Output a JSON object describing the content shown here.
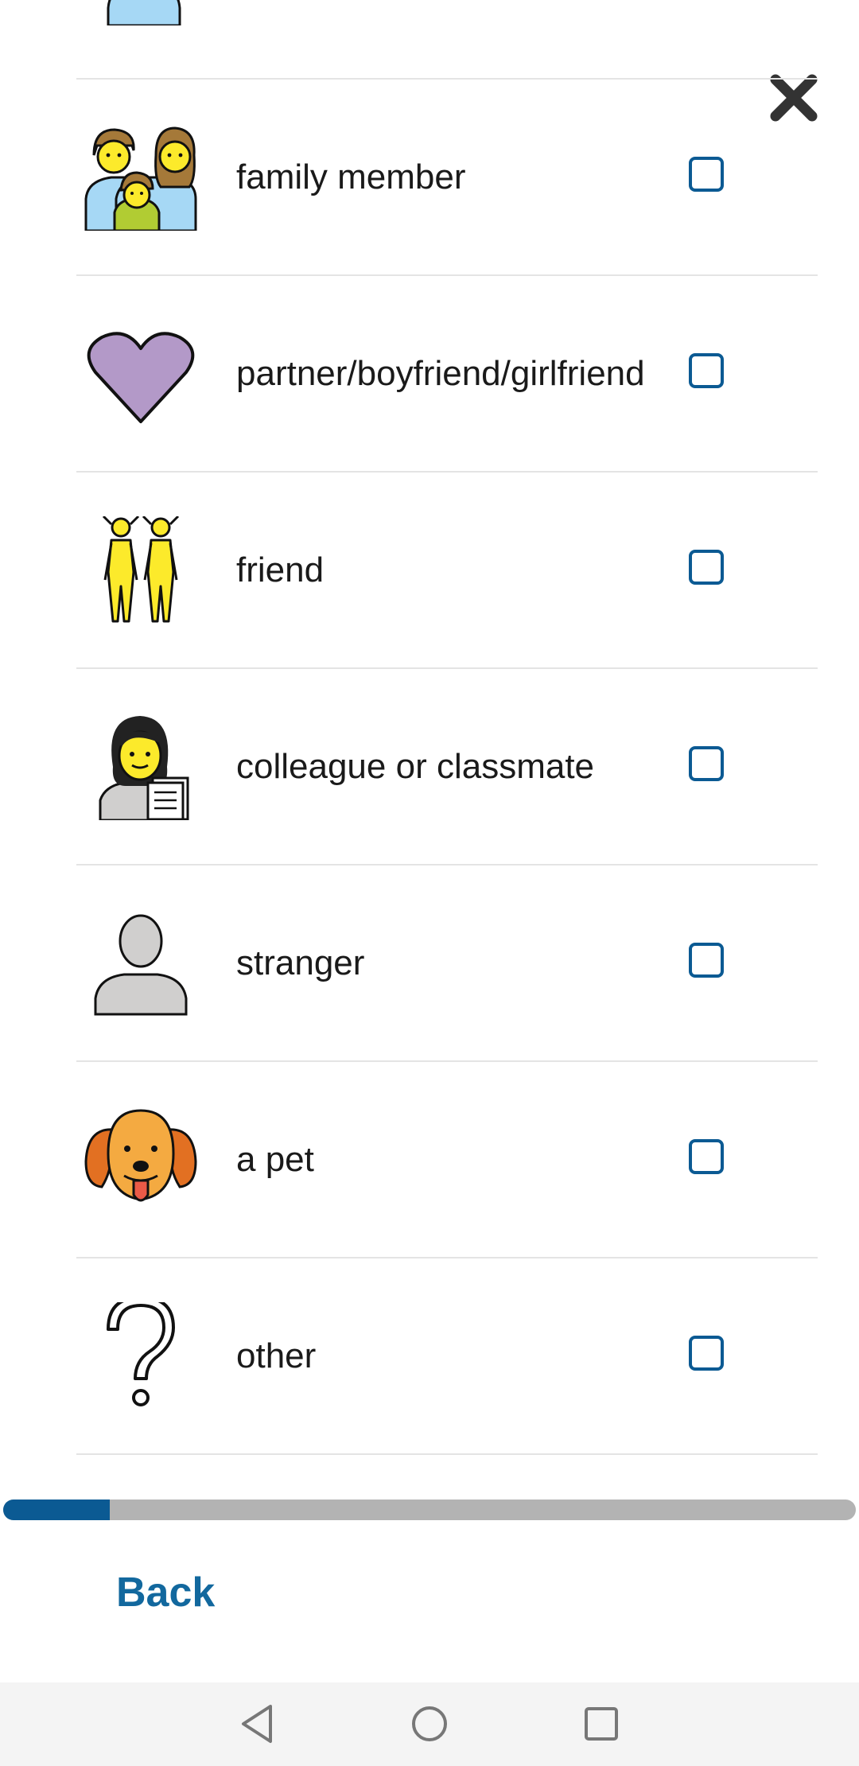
{
  "options": [
    {
      "label": "family member",
      "icon": "family-icon",
      "checked": false
    },
    {
      "label": "partner/boyfriend/girlfriend",
      "icon": "heart-icon",
      "checked": false
    },
    {
      "label": "friend",
      "icon": "friends-icon",
      "checked": false
    },
    {
      "label": "colleague or classmate",
      "icon": "office-worker-icon",
      "checked": false
    },
    {
      "label": "stranger",
      "icon": "person-silhouette-icon",
      "checked": false
    },
    {
      "label": "a pet",
      "icon": "dog-icon",
      "checked": false
    },
    {
      "label": "other",
      "icon": "question-mark-icon",
      "checked": false
    }
  ],
  "progress": {
    "value": 0.125
  },
  "footer": {
    "back_label": "Back"
  },
  "close_icon": "close-icon",
  "colors": {
    "accent": "#0b5a93",
    "link": "#12689e",
    "progress_track": "#b3b3b3"
  }
}
